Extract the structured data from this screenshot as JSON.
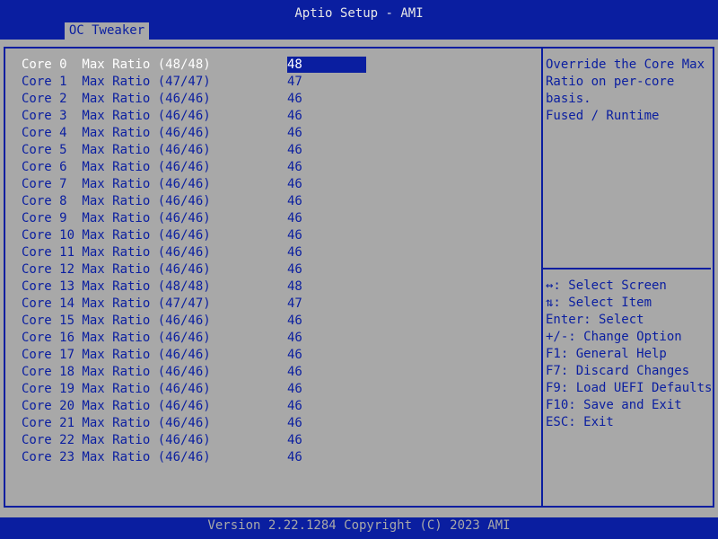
{
  "header": {
    "title": "Aptio Setup - AMI",
    "tab": "OC Tweaker"
  },
  "settings": [
    {
      "label": "Core 0  Max Ratio (48/48)",
      "value": "48"
    },
    {
      "label": "Core 1  Max Ratio (47/47)",
      "value": "47"
    },
    {
      "label": "Core 2  Max Ratio (46/46)",
      "value": "46"
    },
    {
      "label": "Core 3  Max Ratio (46/46)",
      "value": "46"
    },
    {
      "label": "Core 4  Max Ratio (46/46)",
      "value": "46"
    },
    {
      "label": "Core 5  Max Ratio (46/46)",
      "value": "46"
    },
    {
      "label": "Core 6  Max Ratio (46/46)",
      "value": "46"
    },
    {
      "label": "Core 7  Max Ratio (46/46)",
      "value": "46"
    },
    {
      "label": "Core 8  Max Ratio (46/46)",
      "value": "46"
    },
    {
      "label": "Core 9  Max Ratio (46/46)",
      "value": "46"
    },
    {
      "label": "Core 10 Max Ratio (46/46)",
      "value": "46"
    },
    {
      "label": "Core 11 Max Ratio (46/46)",
      "value": "46"
    },
    {
      "label": "Core 12 Max Ratio (46/46)",
      "value": "46"
    },
    {
      "label": "Core 13 Max Ratio (48/48)",
      "value": "48"
    },
    {
      "label": "Core 14 Max Ratio (47/47)",
      "value": "47"
    },
    {
      "label": "Core 15 Max Ratio (46/46)",
      "value": "46"
    },
    {
      "label": "Core 16 Max Ratio (46/46)",
      "value": "46"
    },
    {
      "label": "Core 17 Max Ratio (46/46)",
      "value": "46"
    },
    {
      "label": "Core 18 Max Ratio (46/46)",
      "value": "46"
    },
    {
      "label": "Core 19 Max Ratio (46/46)",
      "value": "46"
    },
    {
      "label": "Core 20 Max Ratio (46/46)",
      "value": "46"
    },
    {
      "label": "Core 21 Max Ratio (46/46)",
      "value": "46"
    },
    {
      "label": "Core 22 Max Ratio (46/46)",
      "value": "46"
    },
    {
      "label": "Core 23 Max Ratio (46/46)",
      "value": "46"
    }
  ],
  "help": {
    "lines": [
      "Override the Core Max",
      "Ratio on per-core",
      "basis.",
      "Fused / Runtime"
    ]
  },
  "keys": [
    "↔: Select Screen",
    "⇅: Select Item",
    "Enter: Select",
    "+/-: Change Option",
    "F1: General Help",
    "F7: Discard Changes",
    "F9: Load UEFI Defaults",
    "F10: Save and Exit",
    "ESC: Exit"
  ],
  "footer": {
    "version": "Version 2.22.1284 Copyright (C) 2023 AMI"
  },
  "colors": {
    "bios_blue": "#0a1ea0",
    "panel_gray": "#a8a8a8",
    "selected_text": "#ffffff"
  }
}
